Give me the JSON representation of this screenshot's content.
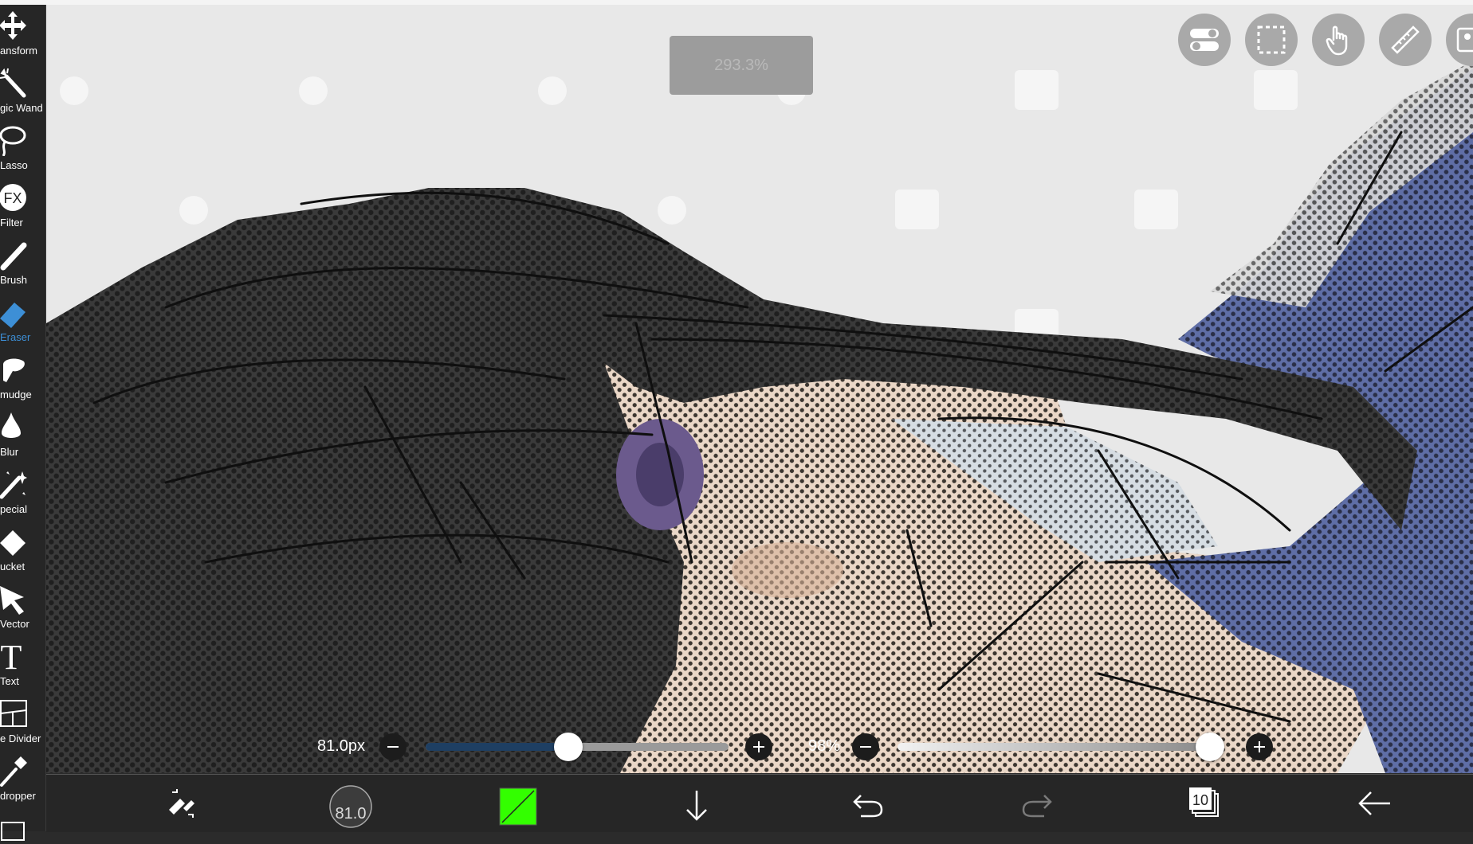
{
  "zoom_indicator": "293.3%",
  "tools": [
    {
      "label": "ansform",
      "icon": "transform-icon"
    },
    {
      "label": "gic Wand",
      "icon": "magic-wand-icon"
    },
    {
      "label": "Lasso",
      "icon": "lasso-icon"
    },
    {
      "label": "Filter",
      "icon": "fx-icon"
    },
    {
      "label": "Brush",
      "icon": "brush-icon"
    },
    {
      "label": "Eraser",
      "icon": "eraser-icon",
      "active": true
    },
    {
      "label": "mudge",
      "icon": "smudge-icon"
    },
    {
      "label": "Blur",
      "icon": "blur-drop-icon"
    },
    {
      "label": "pecial",
      "icon": "special-wand-icon"
    },
    {
      "label": "ucket",
      "icon": "bucket-icon"
    },
    {
      "label": "Vector",
      "icon": "vector-arrow-icon"
    },
    {
      "label": "Text",
      "icon": "text-icon"
    },
    {
      "label": "e Divider",
      "icon": "frame-divider-icon"
    },
    {
      "label": "dropper",
      "icon": "eyedropper-icon"
    }
  ],
  "top_buttons": [
    "toggle-icon",
    "selection-icon",
    "hand-icon",
    "ruler-icon",
    "reference-icon"
  ],
  "brush_size": {
    "label": "81.0px",
    "value_fraction": 0.47
  },
  "opacity": {
    "label": "98%",
    "value_fraction": 0.98
  },
  "bottom_bar": {
    "brush_size_display": "81.0",
    "layer_count": "10",
    "primary_color": "#33ff00",
    "icons": [
      "swap-tools-icon",
      "brush-size-icon",
      "color-icon",
      "download-icon",
      "undo-icon",
      "redo-icon",
      "layers-icon",
      "back-icon"
    ]
  },
  "colors": {
    "accent": "#3d8fd6",
    "toolbar": "#262626",
    "slider_fill": "#1e3f63"
  }
}
